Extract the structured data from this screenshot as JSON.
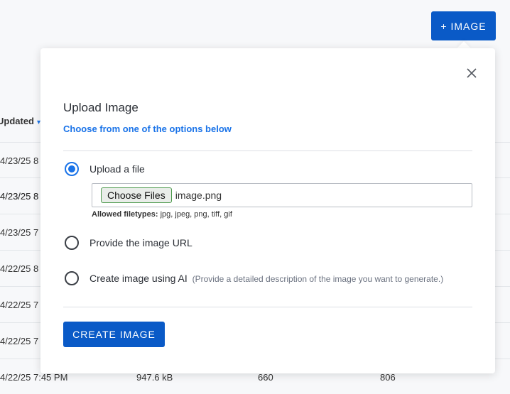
{
  "toolbar": {
    "image_button_label": "+ IMAGE"
  },
  "background_table": {
    "header_updated": "Updated",
    "rows": [
      {
        "updated": "4/23/25 8"
      },
      {
        "updated": "4/23/25 8"
      },
      {
        "updated": "4/23/25 7"
      },
      {
        "updated": "4/22/25 8"
      },
      {
        "updated": "4/22/25 7"
      },
      {
        "updated": "4/22/25 7"
      },
      {
        "updated": "4/22/25 7:45 PM",
        "size": "947.6 kB",
        "width": "660",
        "height": "806"
      }
    ]
  },
  "modal": {
    "title": "Upload Image",
    "subtitle": "Choose from one of the options below",
    "options": [
      {
        "label": "Upload a file",
        "selected": true
      },
      {
        "label": "Provide the image URL",
        "selected": false
      },
      {
        "label": "Create image using AI",
        "hint": "(Provide a detailed description of the image you want to generate.)",
        "selected": false
      }
    ],
    "file_input": {
      "button_label": "Choose Files",
      "file_name": "image.png"
    },
    "allowed_label": "Allowed filetypes:",
    "allowed_types": "jpg, jpeg, png, tiff, gif",
    "submit_label": "CREATE IMAGE"
  },
  "colors": {
    "accent": "#1a73e8",
    "primary_button": "#0a5ac7"
  }
}
